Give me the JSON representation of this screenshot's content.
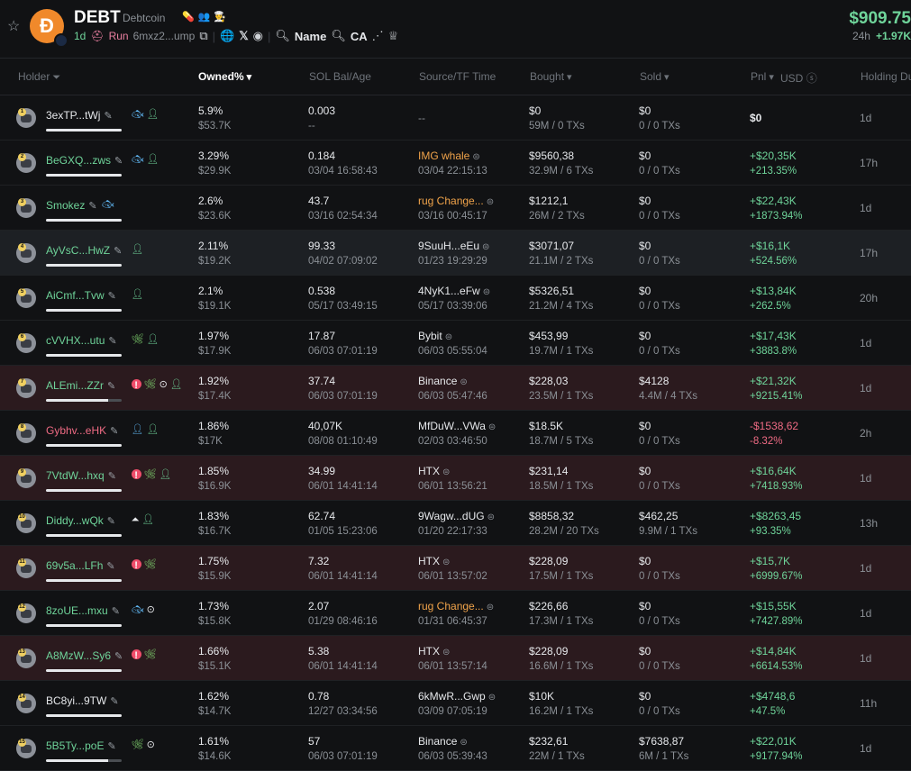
{
  "token": {
    "ticker": "DEBT",
    "name": "Debtcoin",
    "logo_letter": "Ð",
    "age": "1d",
    "run_label": "Run",
    "mint": "6mxz2...ump",
    "name_search": "Name",
    "ca_search": "CA",
    "price": "$909.75",
    "change_label": "24h",
    "change_value": "+1.97K"
  },
  "table": {
    "headers": {
      "holder": "Holder",
      "owned": "Owned%",
      "sol": "SOL Bal/Age",
      "source": "Source/TF Time",
      "bought": "Bought",
      "sold": "Sold",
      "pnl": "Pnl",
      "usd": "USD",
      "holding": "Holding Du"
    },
    "rows": [
      {
        "rank": "1",
        "addr": "3exTP...tWj",
        "addr_color": "#e6e8eb",
        "owned": "5.9%",
        "owned_usd": "$53.7K",
        "sol": "0.003",
        "sol_age": "--",
        "source": "--",
        "source_time": "",
        "bought": "$0",
        "bought_sub": "59M / 0 TXs",
        "sold": "$0",
        "sold_sub": "0 / 0 TXs",
        "pnl": "$0",
        "pnl_pct": "",
        "hold": "1d",
        "bg": "",
        "tags": [
          "fish",
          "user"
        ],
        "bar": "full"
      },
      {
        "rank": "2",
        "addr": "BeGXQ...zws",
        "addr_color": "#6fd49a",
        "owned": "3.29%",
        "owned_usd": "$29.9K",
        "sol": "0.184",
        "sol_age": "03/04 16:58:43",
        "source": "IMG whale",
        "source_time": "03/04 22:15:13",
        "bought": "$9560,38",
        "bought_sub": "32.9M / 6 TXs",
        "sold": "$0",
        "sold_sub": "0 / 0 TXs",
        "pnl": "+$20,35K",
        "pnl_pct": "+213.35%",
        "hold": "17h",
        "bg": "",
        "tags": [
          "fish",
          "user"
        ],
        "bar": "full",
        "src_orange": true
      },
      {
        "rank": "3",
        "addr": "Smokez",
        "addr_color": "#6fd49a",
        "owned": "2.6%",
        "owned_usd": "$23.6K",
        "sol": "43.7",
        "sol_age": "03/16 02:54:34",
        "source": "rug Change...",
        "source_time": "03/16 00:45:17",
        "bought": "$1212,1",
        "bought_sub": "26M / 2 TXs",
        "sold": "$0",
        "sold_sub": "0 / 0 TXs",
        "pnl": "+$22,43K",
        "pnl_pct": "+1873.94%",
        "hold": "1d",
        "bg": "",
        "tags": [
          "fish"
        ],
        "bar": "full",
        "src_orange": true
      },
      {
        "rank": "4",
        "addr": "AyVsC...HwZ",
        "addr_color": "#6fd49a",
        "owned": "2.11%",
        "owned_usd": "$19.2K",
        "sol": "99.33",
        "sol_age": "04/02 07:09:02",
        "source": "9SuuH...eEu",
        "source_time": "01/23 19:29:29",
        "bought": "$3071,07",
        "bought_sub": "21.1M / 2 TXs",
        "sold": "$0",
        "sold_sub": "0 / 0 TXs",
        "pnl": "+$16,1K",
        "pnl_pct": "+524.56%",
        "hold": "17h",
        "bg": "hl",
        "tags": [
          "user"
        ],
        "bar": "full"
      },
      {
        "rank": "5",
        "addr": "AiCmf...Tvw",
        "addr_color": "#6fd49a",
        "owned": "2.1%",
        "owned_usd": "$19.1K",
        "sol": "0.538",
        "sol_age": "05/17 03:49:15",
        "source": "4NyK1...eFw",
        "source_time": "05/17 03:39:06",
        "bought": "$5326,51",
        "bought_sub": "21.2M / 4 TXs",
        "sold": "$0",
        "sold_sub": "0 / 0 TXs",
        "pnl": "+$13,84K",
        "pnl_pct": "+262.5%",
        "hold": "20h",
        "bg": "",
        "tags": [
          "user"
        ],
        "bar": "full"
      },
      {
        "rank": "6",
        "addr": "cVVHX...utu",
        "addr_color": "#6fd49a",
        "owned": "1.97%",
        "owned_usd": "$17.9K",
        "sol": "17.87",
        "sol_age": "06/03 07:01:19",
        "source": "Bybit",
        "source_time": "06/03 05:55:04",
        "bought": "$453,99",
        "bought_sub": "19.7M / 1 TXs",
        "sold": "$0",
        "sold_sub": "0 / 0 TXs",
        "pnl": "+$17,43K",
        "pnl_pct": "+3883.8%",
        "hold": "1d",
        "bg": "",
        "tags": [
          "leaf",
          "user"
        ],
        "bar": "full"
      },
      {
        "rank": "7",
        "addr": "ALEmi...ZZr",
        "addr_color": "#6fd49a",
        "owned": "1.92%",
        "owned_usd": "$17.4K",
        "sol": "37.74",
        "sol_age": "06/03 07:01:19",
        "source": "Binance",
        "source_time": "06/03 05:47:46",
        "bought": "$228,03",
        "bought_sub": "23.5M / 1 TXs",
        "sold": "$4128",
        "sold_sub": "4.4M / 4 TXs",
        "pnl": "+$21,32K",
        "pnl_pct": "+9215.41%",
        "hold": "1d",
        "bg": "red",
        "tags": [
          "warn",
          "leaf",
          "target",
          "user"
        ],
        "bar": "partial"
      },
      {
        "rank": "8",
        "addr": "Gybhv...eHK",
        "addr_color": "#ef6b84",
        "owned": "1.86%",
        "owned_usd": "$17K",
        "sol": "40,07K",
        "sol_age": "08/08 01:10:49",
        "source": "MfDuW...VWa",
        "source_time": "02/03 03:46:50",
        "bought": "$18.5K",
        "bought_sub": "18.7M / 5 TXs",
        "sold": "$0",
        "sold_sub": "0 / 0 TXs",
        "pnl": "-$1538,62",
        "pnl_pct": "-8.32%",
        "hold": "2h",
        "bg": "",
        "tags": [
          "person",
          "user"
        ],
        "bar": "full",
        "neg": true
      },
      {
        "rank": "9",
        "addr": "7VtdW...hxq",
        "addr_color": "#6fd49a",
        "owned": "1.85%",
        "owned_usd": "$16.9K",
        "sol": "34.99",
        "sol_age": "06/01 14:41:14",
        "source": "HTX",
        "source_time": "06/01 13:56:21",
        "bought": "$231,14",
        "bought_sub": "18.5M / 1 TXs",
        "sold": "$0",
        "sold_sub": "0 / 0 TXs",
        "pnl": "+$16,64K",
        "pnl_pct": "+7418.93%",
        "hold": "1d",
        "bg": "red",
        "tags": [
          "warn",
          "leaf",
          "user"
        ],
        "bar": "full"
      },
      {
        "rank": "10",
        "addr": "Diddy...wQk",
        "addr_color": "#6fd49a",
        "owned": "1.83%",
        "owned_usd": "$16.7K",
        "sol": "62.74",
        "sol_age": "01/05 15:23:06",
        "source": "9Wagw...dUG",
        "source_time": "01/20 22:17:33",
        "bought": "$8858,32",
        "bought_sub": "28.2M / 20 TXs",
        "sold": "$462,25",
        "sold_sub": "9.9M / 1 TXs",
        "pnl": "+$8263,45",
        "pnl_pct": "+93.35%",
        "hold": "13h",
        "bg": "",
        "tags": [
          "tri",
          "user"
        ],
        "bar": "full"
      },
      {
        "rank": "11",
        "addr": "69v5a...LFh",
        "addr_color": "#6fd49a",
        "owned": "1.75%",
        "owned_usd": "$15.9K",
        "sol": "7.32",
        "sol_age": "06/01 14:41:14",
        "source": "HTX",
        "source_time": "06/01 13:57:02",
        "bought": "$228,09",
        "bought_sub": "17.5M / 1 TXs",
        "sold": "$0",
        "sold_sub": "0 / 0 TXs",
        "pnl": "+$15,7K",
        "pnl_pct": "+6999.67%",
        "hold": "1d",
        "bg": "red",
        "tags": [
          "warn",
          "leaf"
        ],
        "bar": "full"
      },
      {
        "rank": "12",
        "addr": "8zoUE...mxu",
        "addr_color": "#6fd49a",
        "owned": "1.73%",
        "owned_usd": "$15.8K",
        "sol": "2.07",
        "sol_age": "01/29 08:46:16",
        "source": "rug Change...",
        "source_time": "01/31 06:45:37",
        "bought": "$226,66",
        "bought_sub": "17.3M / 1 TXs",
        "sold": "$0",
        "sold_sub": "0 / 0 TXs",
        "pnl": "+$15,55K",
        "pnl_pct": "+7427.89%",
        "hold": "1d",
        "bg": "",
        "tags": [
          "fish",
          "target"
        ],
        "bar": "full",
        "src_orange": true
      },
      {
        "rank": "13",
        "addr": "A8MzW...Sy6",
        "addr_color": "#6fd49a",
        "owned": "1.66%",
        "owned_usd": "$15.1K",
        "sol": "5.38",
        "sol_age": "06/01 14:41:14",
        "source": "HTX",
        "source_time": "06/01 13:57:14",
        "bought": "$228,09",
        "bought_sub": "16.6M / 1 TXs",
        "sold": "$0",
        "sold_sub": "0 / 0 TXs",
        "pnl": "+$14,84K",
        "pnl_pct": "+6614.53%",
        "hold": "1d",
        "bg": "red",
        "tags": [
          "warn",
          "leaf"
        ],
        "bar": "full"
      },
      {
        "rank": "14",
        "addr": "BC8yi...9TW",
        "addr_color": "#e6e8eb",
        "owned": "1.62%",
        "owned_usd": "$14.7K",
        "sol": "0.78",
        "sol_age": "12/27 03:34:56",
        "source": "6kMwR...Gwp",
        "source_time": "03/09 07:05:19",
        "bought": "$10K",
        "bought_sub": "16.2M / 1 TXs",
        "sold": "$0",
        "sold_sub": "0 / 0 TXs",
        "pnl": "+$4748,6",
        "pnl_pct": "+47.5%",
        "hold": "11h",
        "bg": "",
        "tags": [],
        "bar": "full"
      },
      {
        "rank": "15",
        "addr": "5B5Ty...poE",
        "addr_color": "#6fd49a",
        "owned": "1.61%",
        "owned_usd": "$14.6K",
        "sol": "57",
        "sol_age": "06/03 07:01:19",
        "source": "Binance",
        "source_time": "06/03 05:39:43",
        "bought": "$232,61",
        "bought_sub": "22M / 1 TXs",
        "sold": "$7638,87",
        "sold_sub": "6M / 1 TXs",
        "pnl": "+$22,01K",
        "pnl_pct": "+9177.94%",
        "hold": "1d",
        "bg": "",
        "tags": [
          "leaf",
          "target"
        ],
        "bar": "partial"
      }
    ]
  }
}
